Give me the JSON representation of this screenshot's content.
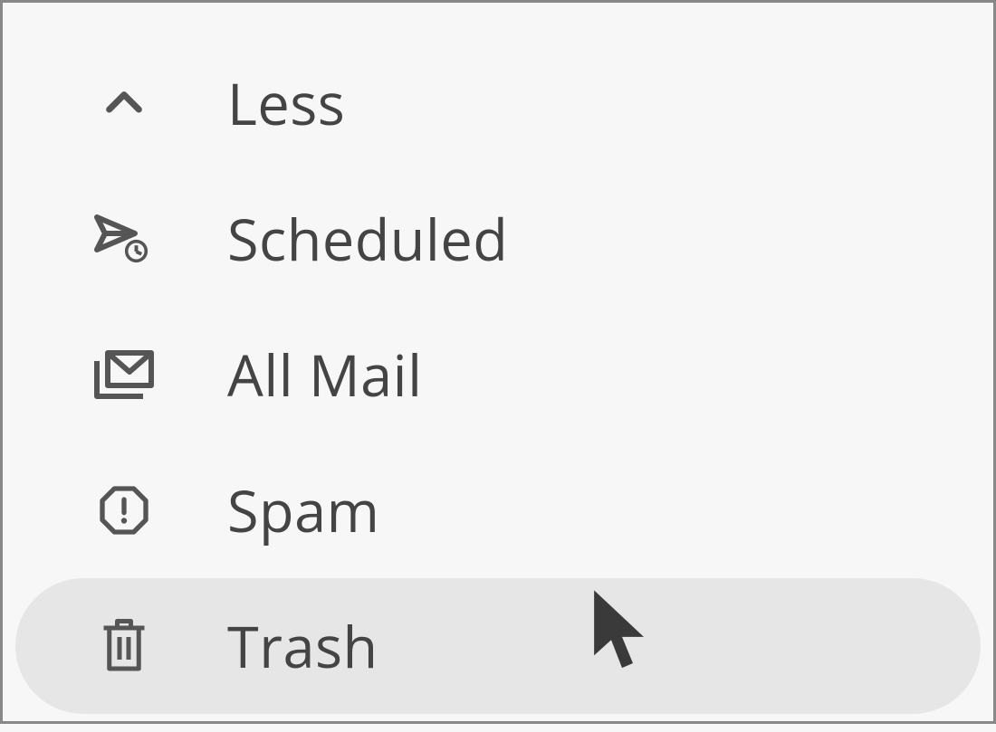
{
  "sidebar": {
    "items": [
      {
        "id": "less",
        "label": "Less",
        "icon": "chevron-up-icon",
        "hover": false
      },
      {
        "id": "scheduled",
        "label": "Scheduled",
        "icon": "scheduled-send-icon",
        "hover": false
      },
      {
        "id": "allmail",
        "label": "All Mail",
        "icon": "all-mail-icon",
        "hover": false
      },
      {
        "id": "spam",
        "label": "Spam",
        "icon": "spam-octagon-icon",
        "hover": false
      },
      {
        "id": "trash",
        "label": "Trash",
        "icon": "trash-icon",
        "hover": true
      }
    ]
  },
  "colors": {
    "icon": "#555555",
    "text": "#444444",
    "hover_bg": "#e6e6e6",
    "page_bg": "#f7f7f7",
    "border": "#888888"
  }
}
